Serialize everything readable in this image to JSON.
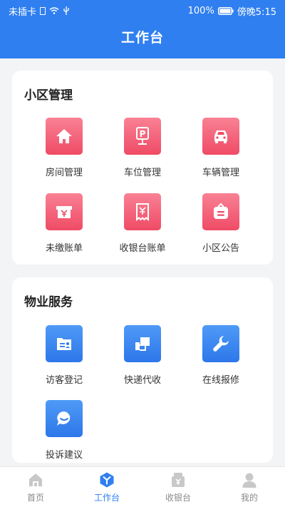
{
  "status_bar": {
    "carrier": "未插卡",
    "battery": "100%",
    "time": "傍晚5:15"
  },
  "header": {
    "title": "工作台"
  },
  "sections": [
    {
      "title": "小区管理",
      "items": [
        {
          "label": "房间管理",
          "icon": "house-icon"
        },
        {
          "label": "车位管理",
          "icon": "parking-icon"
        },
        {
          "label": "车辆管理",
          "icon": "car-icon"
        },
        {
          "label": "未缴账单",
          "icon": "unpaid-bill-icon"
        },
        {
          "label": "收银台账单",
          "icon": "receipt-icon"
        },
        {
          "label": "小区公告",
          "icon": "notice-icon"
        }
      ]
    },
    {
      "title": "物业服务",
      "items": [
        {
          "label": "访客登记",
          "icon": "visitor-card-icon"
        },
        {
          "label": "快递代收",
          "icon": "package-icon"
        },
        {
          "label": "在线报修",
          "icon": "wrench-icon"
        },
        {
          "label": "投诉建议",
          "icon": "chat-icon"
        }
      ]
    }
  ],
  "tabbar": [
    {
      "label": "首页",
      "icon": "home-icon",
      "active": false
    },
    {
      "label": "工作台",
      "icon": "workbench-icon",
      "active": true
    },
    {
      "label": "收银台",
      "icon": "cashier-icon",
      "active": false
    },
    {
      "label": "我的",
      "icon": "profile-icon",
      "active": false
    }
  ],
  "colors": {
    "primary": "#2f7ff0",
    "tile_pink": "#ef4b66",
    "tile_blue": "#2d77ea",
    "tab_inactive": "#8a8a8a"
  }
}
